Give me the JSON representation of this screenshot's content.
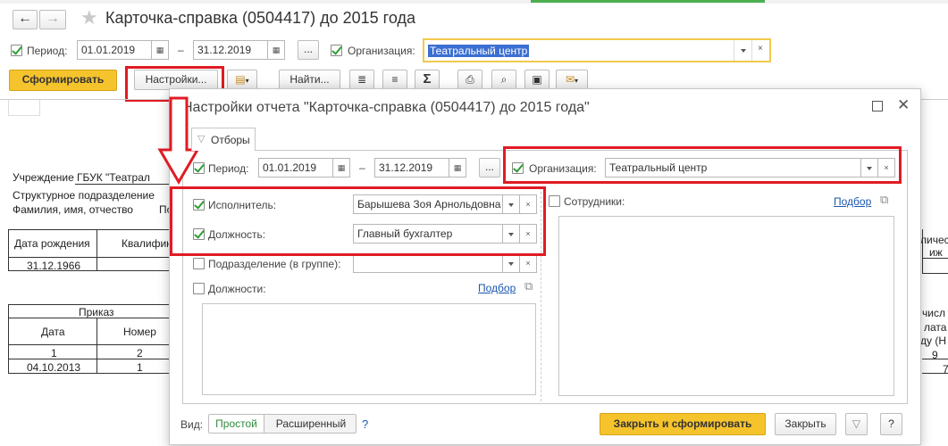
{
  "window": {
    "title": "Карточка-справка (0504417) до 2015 года"
  },
  "toolbar": {
    "period_label": "Период:",
    "period_from": "01.01.2019",
    "period_dash": "–",
    "period_to": "31.12.2019",
    "ellipsis": "...",
    "org_label": "Организация:",
    "org_value": "Театральный центр",
    "generate_label": "Сформировать",
    "settings_label": "Настройки...",
    "find_label": "Найти...",
    "sum_symbol": "Σ"
  },
  "report": {
    "institution_label": "Учреждение",
    "institution_value": "ГБУК \"Театрал",
    "department_label": "Структурное подразделение",
    "fio_label": "Фамилия, имя, отчество",
    "fio_value": "По",
    "birth_label": "Дата рождения",
    "qual_label": "Квалифик",
    "birth_value": "31.12.1966",
    "order_label": "Приказ",
    "date_label": "Дата",
    "number_label": "Номер",
    "col1": "1",
    "col2": "2",
    "order_date": "04.10.2013",
    "order_number": "1",
    "right_col1": "личес",
    "right_col2": "иж",
    "right_col3": "числ",
    "right_col4": "лата",
    "right_col5": "ду (Н",
    "right_num1": "9",
    "right_num2": "7"
  },
  "dialog": {
    "title": "Настройки отчета \"Карточка-справка (0504417) до 2015 года\"",
    "tab_filters": "Отборы",
    "period_label": "Период:",
    "period_from": "01.01.2019",
    "period_dash": "–",
    "period_to": "31.12.2019",
    "ellipsis": "...",
    "org_label": "Организация:",
    "org_value": "Театральный центр",
    "executor_label": "Исполнитель:",
    "executor_value": "Барышева Зоя Арнольдовна",
    "position_label": "Должность:",
    "position_value": "Главный бухгалтер",
    "division_label": "Подразделение (в группе):",
    "positions_label": "Должности:",
    "positions_pick": "Подбор",
    "employees_label": "Сотрудники:",
    "employees_pick": "Подбор",
    "view_label": "Вид:",
    "view_simple": "Простой",
    "view_extended": "Расширенный",
    "help_q": "?",
    "close_generate": "Закрыть и сформировать",
    "close": "Закрыть",
    "help_btn": "?"
  },
  "colors": {
    "accent_yellow": "#f5c32c",
    "highlight_red": "#e01b24",
    "check_green": "#2e9d35",
    "link_blue": "#1a57b0"
  }
}
